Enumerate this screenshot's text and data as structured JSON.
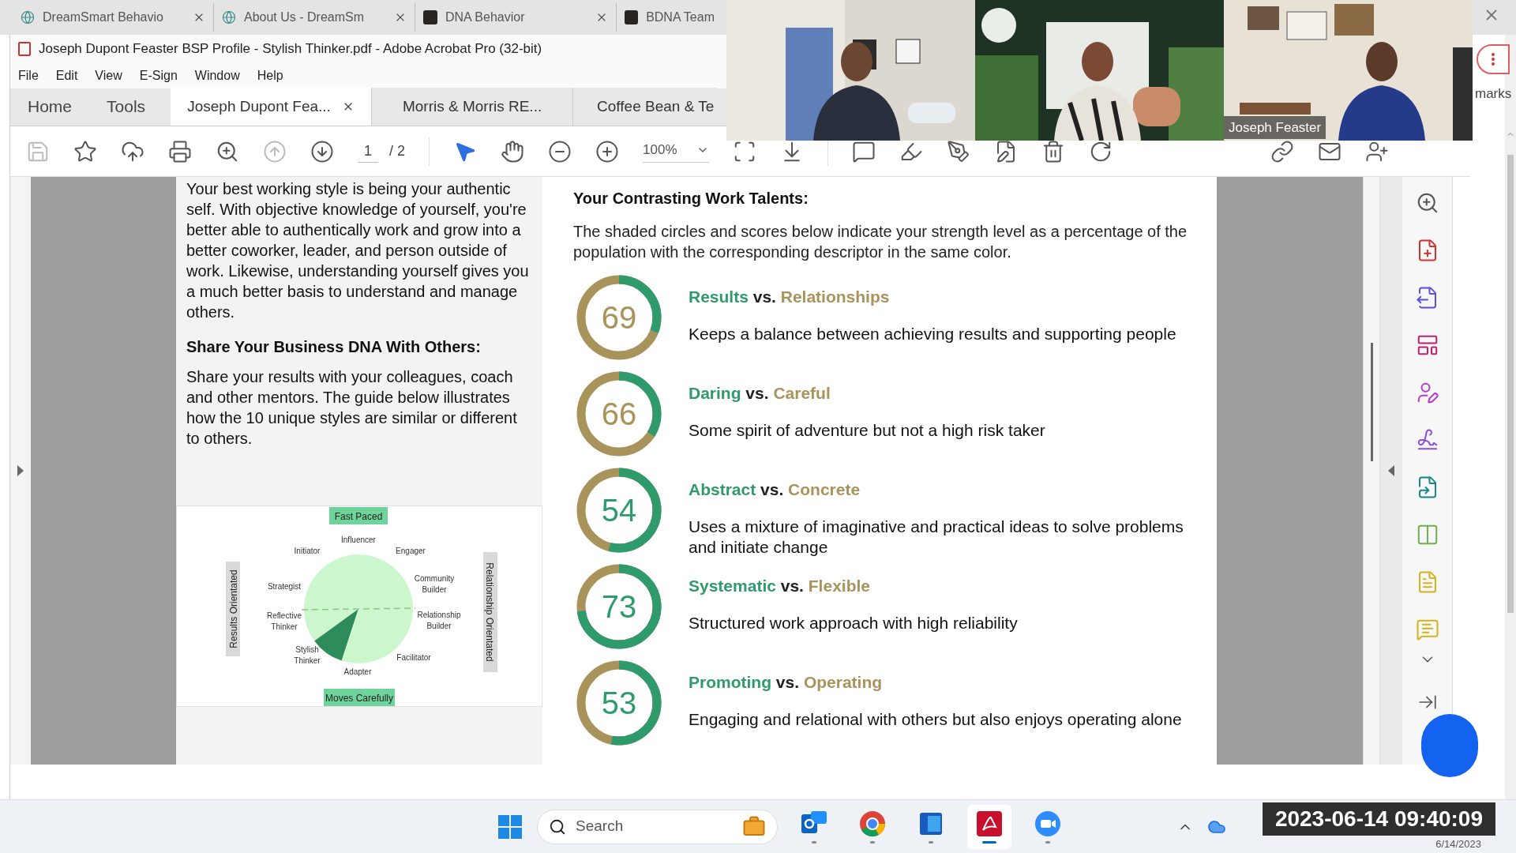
{
  "browser_tabs": [
    {
      "title": "DreamSmart Behavio",
      "kind": "globe"
    },
    {
      "title": "About Us - DreamSm",
      "kind": "globe"
    },
    {
      "title": "DNA Behavior",
      "kind": "dark"
    },
    {
      "title": "BDNA Team",
      "kind": "dark"
    }
  ],
  "window": {
    "title": "Joseph Dupont Feaster BSP Profile - Stylish Thinker.pdf - Adobe Acrobat Pro (32-bit)"
  },
  "menu": [
    "File",
    "Edit",
    "View",
    "E-Sign",
    "Window",
    "Help"
  ],
  "nav": [
    "Home",
    "Tools"
  ],
  "doc_tabs": [
    {
      "label": "Joseph Dupont Fea...",
      "selected": true
    },
    {
      "label": "Morris & Morris RE...",
      "selected": false
    },
    {
      "label": "Coffee Bean & Te",
      "selected": false
    }
  ],
  "toolbar": {
    "page": "1",
    "page_count": "/ 2",
    "zoom": "100%"
  },
  "left_column": {
    "intro": "Your best working style is being your authentic self. With objective knowledge of yourself, you're better able to authentically work and grow into a better coworker, leader, and person outside of work. Likewise, understanding yourself gives you a much better basis to understand and manage others.",
    "heading": "Share Your Business DNA With Others:",
    "text": "Share your results with your colleagues, coach and other mentors. The guide below illustrates how the 10 unique styles are similar or different to others.",
    "diagram": {
      "top": "Fast Paced",
      "bottom": "Moves Carefully",
      "left": "Results Orientated",
      "right": "Relationship Orientated",
      "segments": [
        {
          "label": "Influencer",
          "selected": false
        },
        {
          "label": "Initiator",
          "selected": false
        },
        {
          "label": "Engager",
          "selected": false
        },
        {
          "label": "Strategist",
          "selected": false
        },
        {
          "label": "Community Builder",
          "selected": false
        },
        {
          "label": "Reflective Thinker",
          "selected": false
        },
        {
          "label": "Relationship Builder",
          "selected": false
        },
        {
          "label": "Stylish Thinker",
          "selected": true
        },
        {
          "label": "Facilitator",
          "selected": false
        },
        {
          "label": "Adapter",
          "selected": false
        }
      ]
    }
  },
  "right_column": {
    "heading": "Your Contrasting Work Talents:",
    "text": "The shaded circles and scores below indicate your strength level as a percentage of the population with the corresponding descriptor in the same color.",
    "talents": [
      {
        "score": "69",
        "level": 0.31,
        "left": "Results",
        "vs": "vs.",
        "right": "Relationships",
        "description": "Keeps a balance between achieving results and supporting people"
      },
      {
        "score": "66",
        "level": 0.34,
        "left": "Daring",
        "vs": "vs.",
        "right": "Careful",
        "description": "Some spirit of adventure but not a high risk taker"
      },
      {
        "score": "54",
        "level": 0.54,
        "left": "Abstract",
        "vs": "vs.",
        "right": "Concrete",
        "description": "Uses a mixture of imaginative and practical ideas to solve problems and initiate change"
      },
      {
        "score": "73",
        "level": 0.73,
        "left": "Systematic",
        "vs": "vs.",
        "right": "Flexible",
        "description": "Structured work approach with high reliability"
      },
      {
        "score": "53",
        "level": 0.53,
        "left": "Promoting",
        "vs": "vs.",
        "right": "Operating",
        "description": "Engaging and relational with others but also enjoys operating alone"
      }
    ]
  },
  "video": {
    "participant_name": "Joseph Feaster"
  },
  "side_label": "marks",
  "taskbar": {
    "search_placeholder": "Search",
    "apps": [
      {
        "kind": "mail",
        "selected": false
      },
      {
        "kind": "browser",
        "selected": false
      },
      {
        "kind": "word",
        "selected": false
      },
      {
        "kind": "pdf",
        "selected": true
      },
      {
        "kind": "meeting",
        "selected": false
      }
    ]
  },
  "recording_timestamp": "2023-06-14 09:40:09",
  "tray_date": "6/14/2023"
}
